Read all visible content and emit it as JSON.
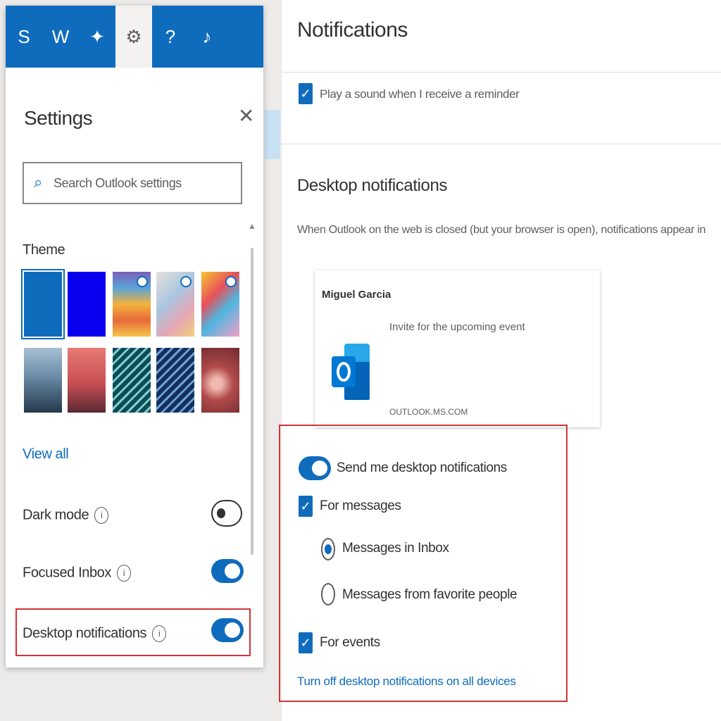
{
  "toolbar": {
    "buttons": [
      {
        "name": "skype-icon",
        "glyph": "S"
      },
      {
        "name": "word-icon",
        "glyph": "W"
      },
      {
        "name": "tips-icon",
        "glyph": "✦"
      },
      {
        "name": "gear-icon",
        "glyph": "⚙"
      },
      {
        "name": "help-icon",
        "glyph": "?"
      },
      {
        "name": "feedback-icon",
        "glyph": "♪"
      }
    ]
  },
  "settings": {
    "title": "Settings",
    "close_glyph": "✕",
    "search_placeholder": "Search Outlook settings",
    "theme_label": "Theme",
    "view_all": "View all",
    "dark_mode": "Dark mode",
    "focused_inbox": "Focused Inbox",
    "desktop_notifications": "Desktop notifications",
    "info_glyph": "i"
  },
  "notifications": {
    "title": "Notifications",
    "play_sound": "Play a sound when I receive a reminder",
    "section_title": "Desktop notifications",
    "description": "When Outlook on the web is closed (but your browser is open), notifications appear in",
    "preview": {
      "sender": "Miguel Garcia",
      "subject": "Invite for the upcoming event",
      "source": "OUTLOOK.MS.COM"
    },
    "send_desktop": "Send me desktop notifications",
    "for_messages": "For messages",
    "messages_in_inbox": "Messages in Inbox",
    "messages_from_favorites": "Messages from favorite people",
    "for_events": "For events",
    "turn_off_link": "Turn off desktop notifications on all devices"
  },
  "colors": {
    "accent": "#0f6cbd",
    "highlight": "#d13438"
  }
}
